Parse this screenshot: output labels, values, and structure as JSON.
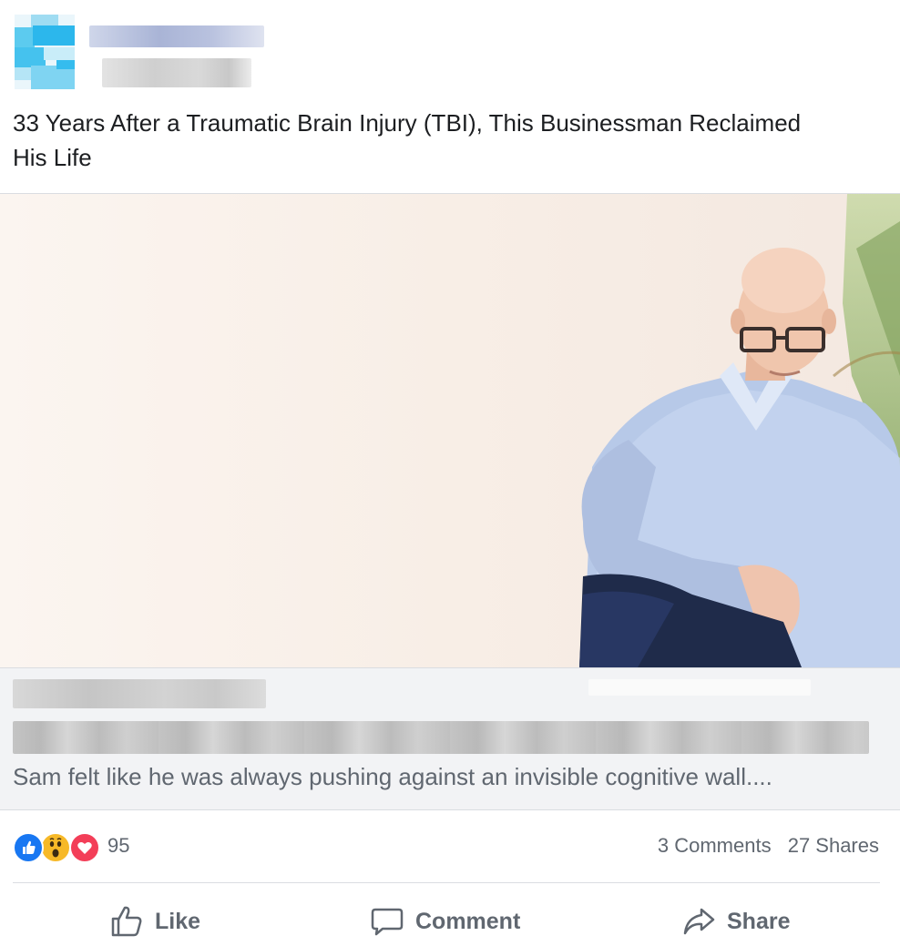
{
  "post": {
    "text": "33 Years After a Traumatic Brain Injury (TBI), This Businessman Reclaimed His Life"
  },
  "link_preview": {
    "description": "Sam felt like he was always pushing against an invisible cognitive wall...."
  },
  "stats": {
    "reaction_icons": [
      "like-icon",
      "wow-icon",
      "love-icon"
    ],
    "reaction_count": "95",
    "comments": "3 Comments",
    "shares": "27 Shares"
  },
  "actions": {
    "like_label": "Like",
    "comment_label": "Comment",
    "share_label": "Share"
  },
  "colors": {
    "like_blue": "#1877f2",
    "wow_yellow": "#f7b928",
    "love_red": "#f33e58",
    "muted_text": "#606770"
  }
}
